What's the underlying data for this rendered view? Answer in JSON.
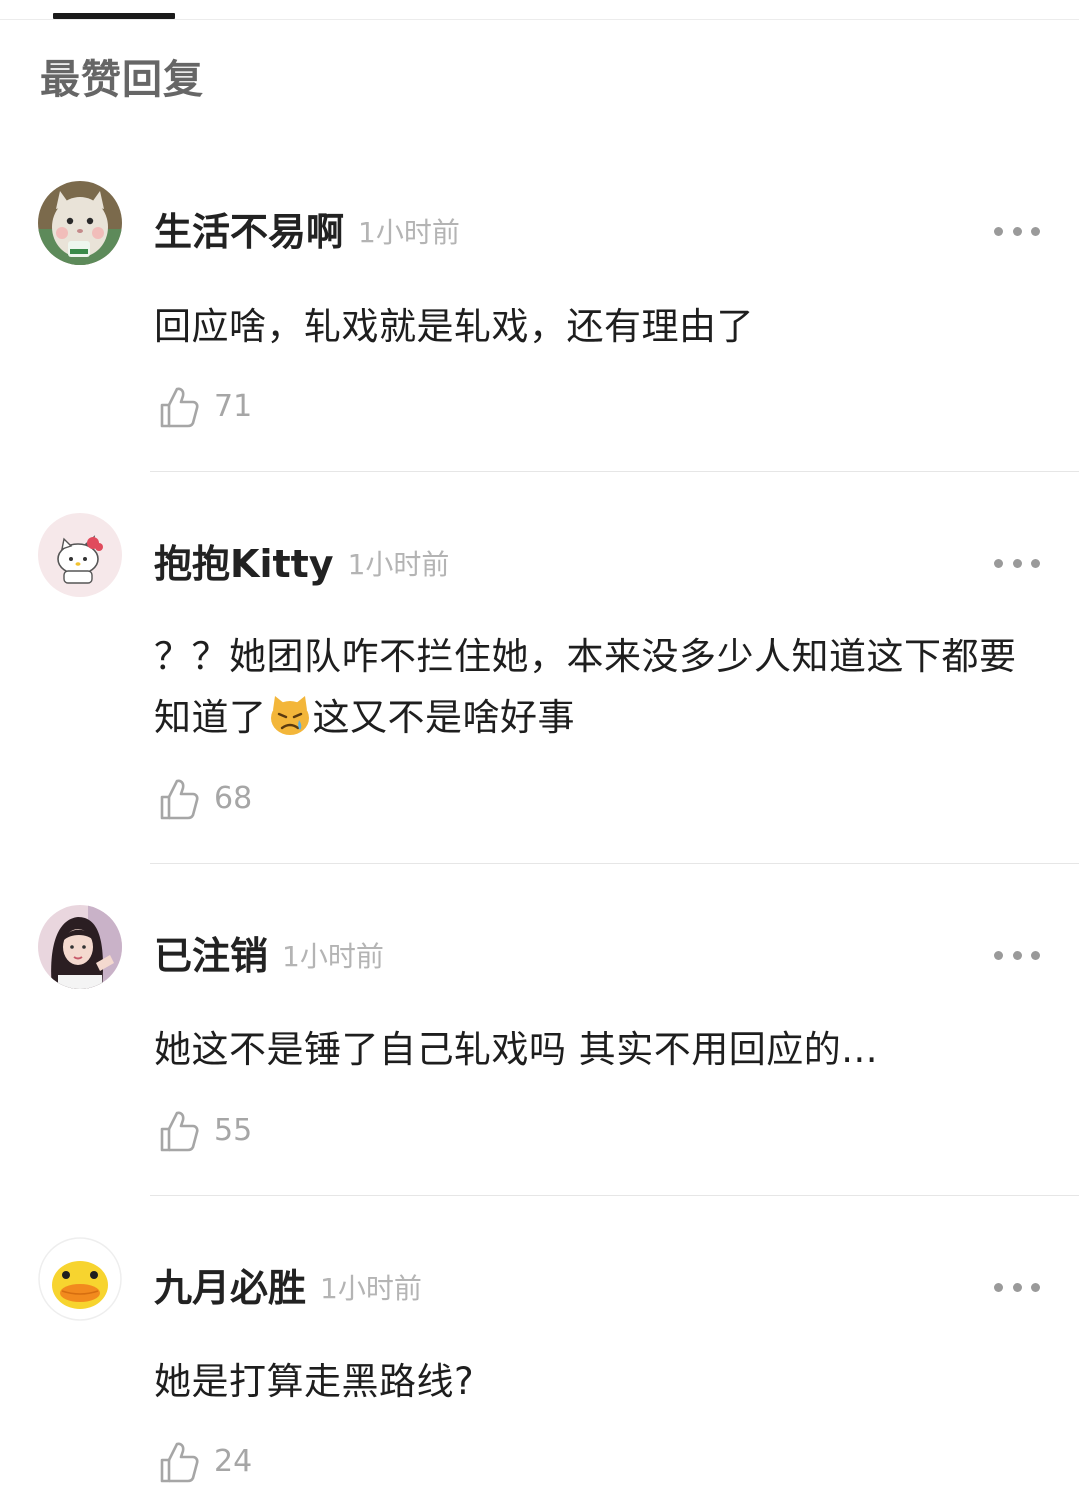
{
  "section_title": "最赞回复",
  "comments": [
    {
      "username": "生活不易啊",
      "time": "1小时前",
      "text": "回应啥，轧戏就是轧戏，还有理由了",
      "likes": "71",
      "avatar": "cat-avatar-icon"
    },
    {
      "username": "抱抱Kitty",
      "time": "1小时前",
      "text_before_emoji": "？？她团队咋不拦住她，本来没多少人知道这下都要知道了",
      "emoji": "crying-cat-emoji-icon",
      "text_after_emoji": "这又不是啥好事",
      "likes": "68",
      "avatar": "hello-kitty-avatar-icon"
    },
    {
      "username": "已注销",
      "time": "1小时前",
      "text": "她这不是锤了自己轧戏吗 其实不用回应的...",
      "likes": "55",
      "avatar": "girl-photo-avatar-icon"
    },
    {
      "username": "九月必胜",
      "time": "1小时前",
      "text": "她是打算走黑路线?",
      "likes": "24",
      "avatar": "yellow-duck-avatar-icon"
    }
  ],
  "colors": {
    "section_title": "#666666",
    "username": "#222222",
    "timestamp": "#b4b4b4",
    "body_text": "#1e1e1e",
    "like_count": "#a6a6a6",
    "divider": "#e6e6e6",
    "tab_indicator": "#1a1a1a"
  }
}
